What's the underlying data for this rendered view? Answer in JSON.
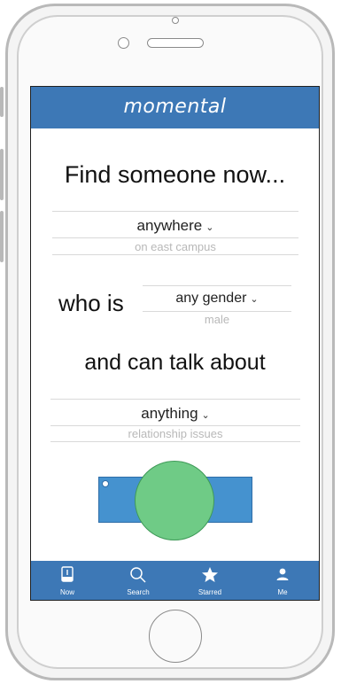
{
  "app": {
    "brand": "momental"
  },
  "main": {
    "headline": "Find someone now...",
    "location_picker": {
      "selected": "anywhere",
      "next_option": "on east campus"
    },
    "who_label": "who is",
    "gender_picker": {
      "selected": "any gender",
      "next_option": "male"
    },
    "talk_label": "and can talk about",
    "topic_picker": {
      "selected": "anything",
      "next_option": "relationship issues"
    }
  },
  "tabbar": {
    "tabs": [
      {
        "label": "Now",
        "icon": "now-icon"
      },
      {
        "label": "Search",
        "icon": "search-icon"
      },
      {
        "label": "Starred",
        "icon": "star-icon"
      },
      {
        "label": "Me",
        "icon": "person-icon"
      }
    ]
  },
  "colors": {
    "primary": "#3d78b6",
    "action_bar": "#4592cf",
    "action_circle": "#6fcb86"
  }
}
